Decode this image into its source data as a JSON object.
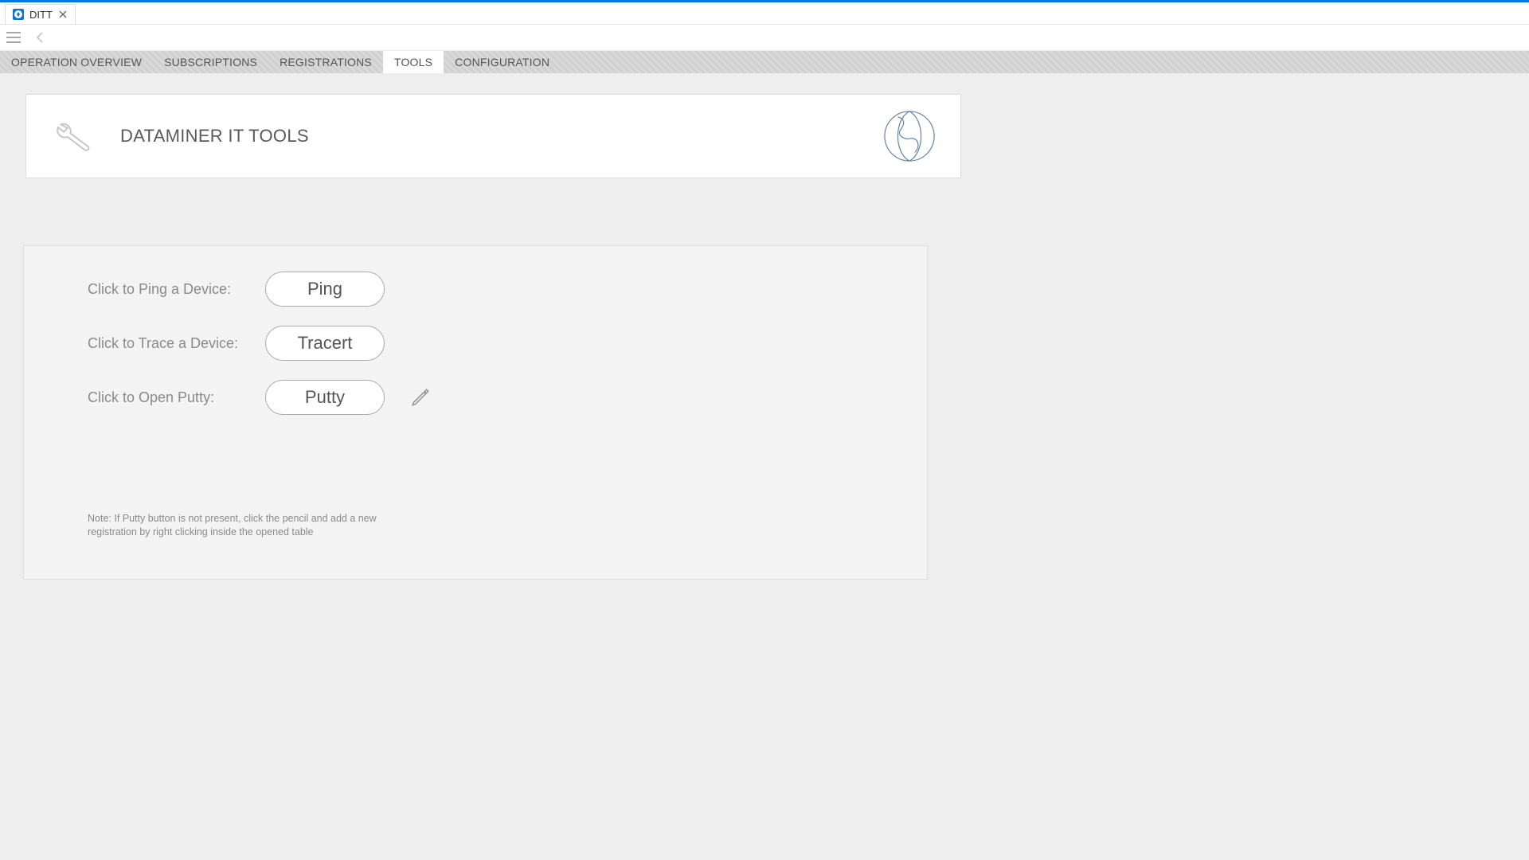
{
  "chrome": {
    "tab_title": "DITT"
  },
  "nav": {
    "tabs": [
      {
        "label": "OPERATION OVERVIEW",
        "active": false
      },
      {
        "label": "SUBSCRIPTIONS",
        "active": false
      },
      {
        "label": "REGISTRATIONS",
        "active": false
      },
      {
        "label": "TOOLS",
        "active": true
      },
      {
        "label": "CONFIGURATION",
        "active": false
      }
    ]
  },
  "header": {
    "title": "DATAMINER IT TOOLS"
  },
  "tools": {
    "ping": {
      "label": "Click to Ping a Device:",
      "button": "Ping"
    },
    "tracert": {
      "label": "Click to Trace a Device:",
      "button": "Tracert"
    },
    "putty": {
      "label": "Click to Open Putty:",
      "button": "Putty"
    }
  },
  "note": "Note: If Putty button is not present, click the pencil and add a new registration by right clicking inside the opened table"
}
